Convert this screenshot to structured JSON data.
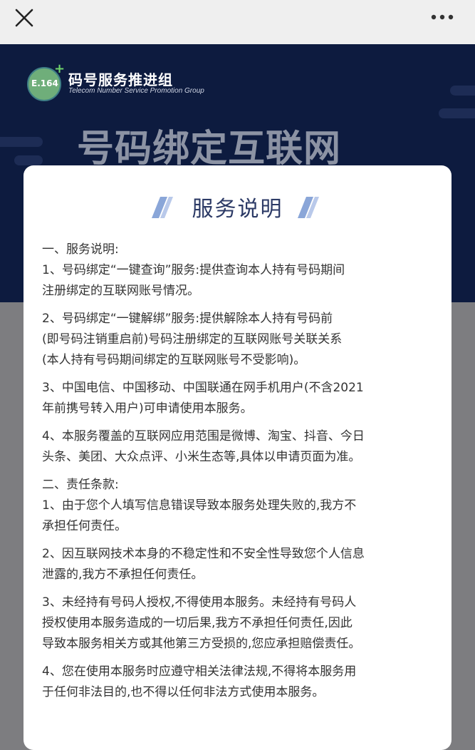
{
  "header": {
    "close_icon": "close-icon",
    "more_icon": "more-options-icon"
  },
  "banner": {
    "logo_text": "E.164",
    "org_name": "码号服务推进组",
    "org_subtitle": "Telecom Number Service Promotion Group",
    "title": "号码绑定互联网"
  },
  "card": {
    "heading": "服务说明",
    "lines": [
      "一、服务说明:",
      "1、号码绑定“一键查询”服务:提供查询本人持有号码期间",
      "注册绑定的互联网账号情况。",
      "2、号码绑定“一键解绑”服务:提供解除本人持有号码前",
      "(即号码注销重启前)号码注册绑定的互联网账号关联关系",
      "(本人持有号码期间绑定的互联网账号不受影响)。",
      "3、中国电信、中国移动、中国联通在网手机用户(不含2021",
      "年前携号转入用户)可申请使用本服务。",
      "4、本服务覆盖的互联网应用范围是微博、淘宝、抖音、今日",
      "头条、美团、大众点评、小米生态等,具体以申请页面为准。",
      "二、责任条款:",
      "1、由于您个人填写信息错误导致本服务处理失败的,我方不",
      "承担任何责任。",
      "2、因互联网技术本身的不稳定性和不安全性导致您个人信息",
      "泄露的,我方不承担任何责任。",
      "3、未经持有号码人授权,不得使用本服务。未经持有号码人",
      "授权使用本服务造成的一切后果,我方不承担任何责任,因此",
      "导致本服务相关方或其他第三方受损的,您应承担赔偿责任。",
      "4、您在使用本服务时应遵守相关法律法规,不得将本服务用",
      "于任何非法目的,也不得以任何非法方式使用本服务。"
    ]
  },
  "colors": {
    "banner_bg": "#0d1b3f",
    "heading": "#2c3a66",
    "accent_stripe": "#8aa6d8"
  }
}
